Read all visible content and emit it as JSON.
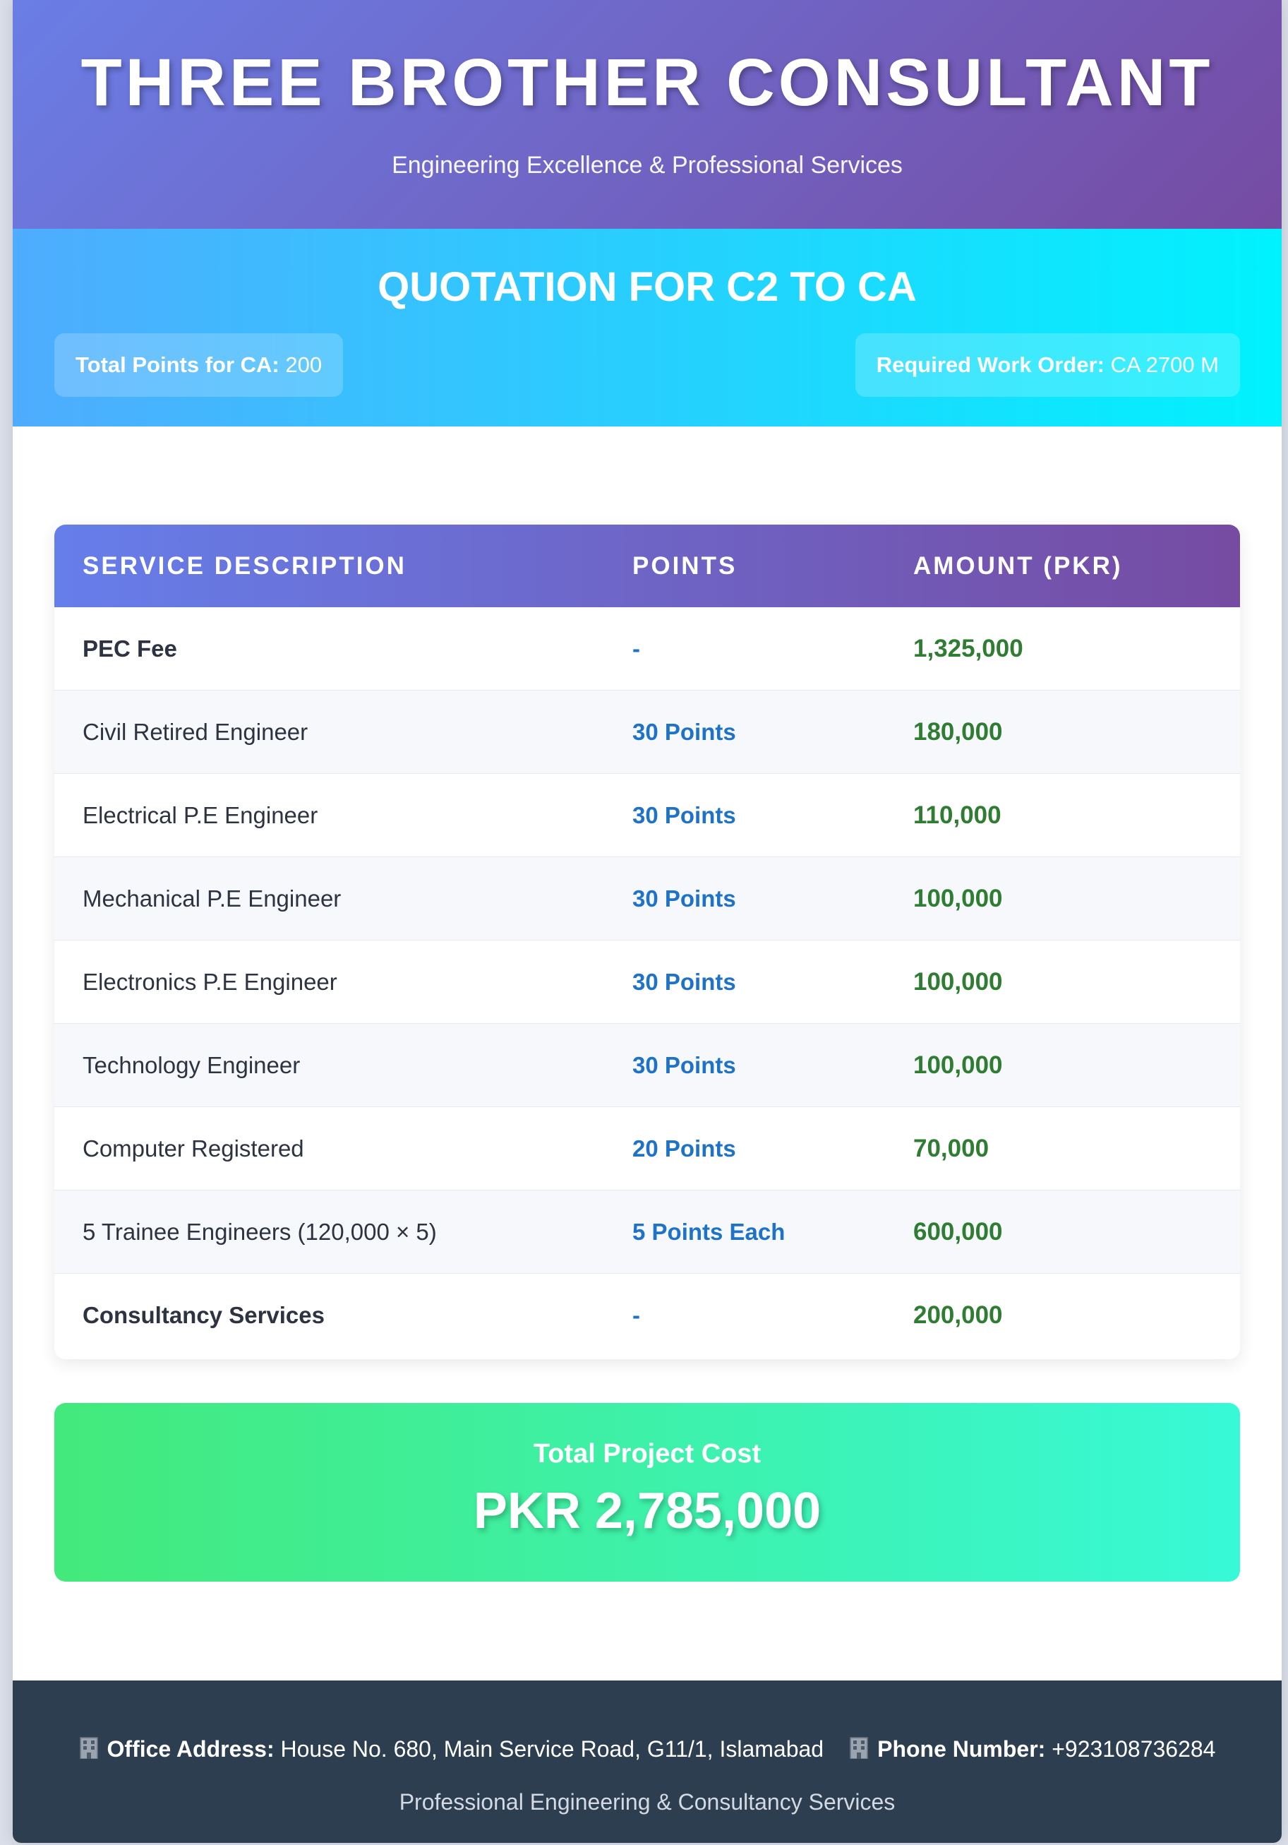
{
  "header": {
    "company_name": "THREE BROTHER CONSULTANT",
    "tagline": "Engineering Excellence & Professional Services"
  },
  "quotation": {
    "title": "QUOTATION FOR C2 TO CA",
    "total_points_label": "Total Points for CA:",
    "total_points_value": "200",
    "work_order_label": "Required Work Order:",
    "work_order_value": "CA 2700 M"
  },
  "table": {
    "headers": [
      "SERVICE DESCRIPTION",
      "POINTS",
      "AMOUNT (PKR)"
    ],
    "rows": [
      {
        "description": "PEC Fee",
        "points": "-",
        "amount": "1,325,000",
        "bold": true
      },
      {
        "description": "Civil Retired Engineer",
        "points": "30 Points",
        "amount": "180,000",
        "bold": false
      },
      {
        "description": "Electrical P.E Engineer",
        "points": "30 Points",
        "amount": "110,000",
        "bold": false
      },
      {
        "description": "Mechanical P.E Engineer",
        "points": "30 Points",
        "amount": "100,000",
        "bold": false
      },
      {
        "description": "Electronics P.E Engineer",
        "points": "30 Points",
        "amount": "100,000",
        "bold": false
      },
      {
        "description": "Technology Engineer",
        "points": "30 Points",
        "amount": "100,000",
        "bold": false
      },
      {
        "description": "Computer Registered",
        "points": "20 Points",
        "amount": "70,000",
        "bold": false
      },
      {
        "description": "5 Trainee Engineers (120,000 × 5)",
        "points": "5 Points Each",
        "amount": "600,000",
        "bold": false
      },
      {
        "description": "Consultancy Services",
        "points": "-",
        "amount": "200,000",
        "bold": true
      }
    ]
  },
  "total": {
    "label": "Total Project Cost",
    "value": "PKR 2,785,000"
  },
  "footer": {
    "address_icon": "office-building-icon",
    "address_label": "Office Address:",
    "address_value": "House No. 680, Main Service Road, G11/1, Islamabad",
    "phone_icon": "office-building-icon",
    "phone_label": "Phone Number:",
    "phone_value": "+923108736284",
    "tagline": "Professional Engineering & Consultancy Services"
  },
  "colors": {
    "header_gradient": [
      "#667eea",
      "#764ba2"
    ],
    "band_gradient": [
      "#4facfe",
      "#00f2fe"
    ],
    "total_gradient": [
      "#43e97b",
      "#38f9d7"
    ],
    "points_text": "#1e73c8",
    "amount_text": "#2e7d32",
    "footer_bg": "#2c3e50"
  }
}
